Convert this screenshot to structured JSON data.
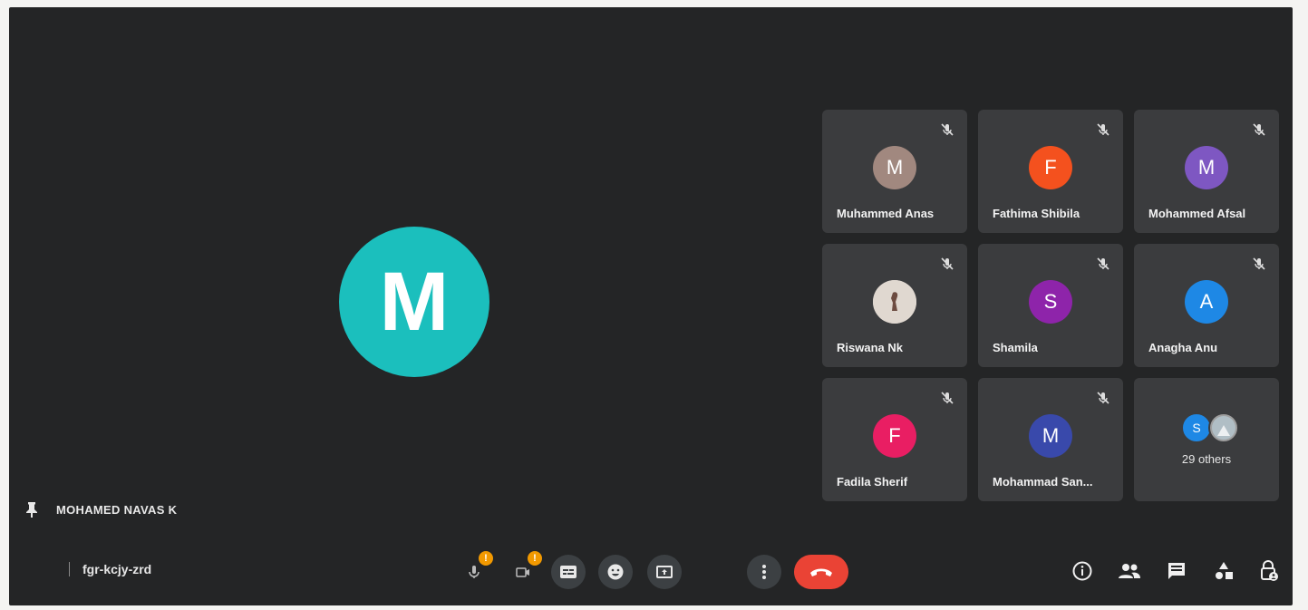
{
  "main": {
    "avatar_initial": "M",
    "avatar_color": "#1bbfbd",
    "pinned_name": "MOHAMED NAVAS K",
    "pin_icon": "pin-icon"
  },
  "participants": [
    {
      "name": "Muhammed Anas",
      "initial": "M",
      "color": "#a1887f",
      "muted": true
    },
    {
      "name": "Fathima Shibila",
      "initial": "F",
      "color": "#f4511e",
      "muted": true
    },
    {
      "name": "Mohammed Afsal",
      "initial": "M",
      "color": "#7e57c2",
      "muted": true
    },
    {
      "name": "Riswana Nk",
      "initial": "",
      "color": "#d7ccc8",
      "muted": true,
      "photo": true
    },
    {
      "name": "Shamila",
      "initial": "S",
      "color": "#8e24aa",
      "muted": true
    },
    {
      "name": "Anagha Anu",
      "initial": "A",
      "color": "#1e88e5",
      "muted": true
    },
    {
      "name": "Fadila Sherif",
      "initial": "F",
      "color": "#e91e63",
      "muted": true
    },
    {
      "name": "Mohammad San...",
      "initial": "M",
      "color": "#3949ab",
      "muted": true
    }
  ],
  "others": {
    "label": "29 others",
    "avatars": [
      {
        "initial": "S",
        "color": "#1e88e5"
      },
      {
        "initial": "",
        "color": "#9e9e9e",
        "photo": true
      }
    ]
  },
  "bottombar": {
    "meeting_code": "fgr-kcjy-zrd",
    "mic_badge": "!",
    "camera_badge": "!"
  },
  "colors": {
    "background": "#242526",
    "tile": "#3b3c3e",
    "control": "#3c4043",
    "end_call": "#ea4335",
    "warning_badge": "#f29900"
  }
}
